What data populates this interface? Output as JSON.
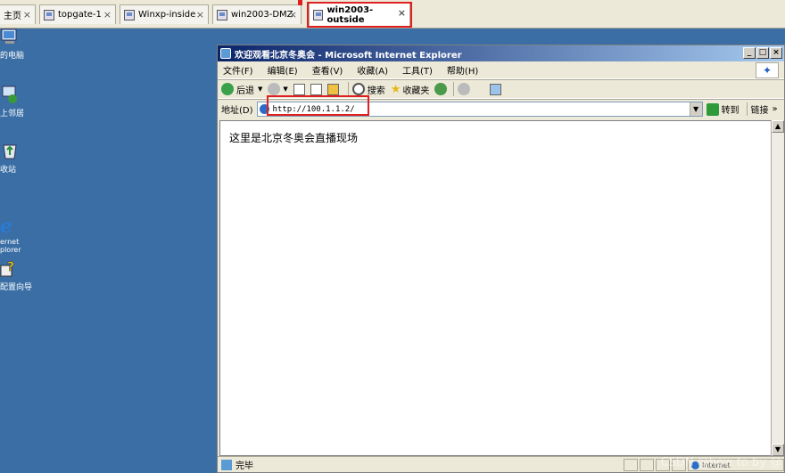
{
  "tabs": [
    {
      "label": "主页"
    },
    {
      "label": "topgate-1"
    },
    {
      "label": "Winxp-inside"
    },
    {
      "label": "win2003-DMZ"
    },
    {
      "label": "win2003-outside"
    }
  ],
  "tab_close_glyph": "×",
  "desktop": {
    "items": [
      {
        "label": "的电脑",
        "icon": "my-computer-icon"
      },
      {
        "label": "上邻居",
        "icon": "network-places-icon"
      },
      {
        "label": "收站",
        "icon": "recycle-bin-icon"
      },
      {
        "label": "ernet\nplorer",
        "icon": "internet-explorer-icon"
      },
      {
        "label": "配置向导",
        "icon": "config-wizard-icon"
      }
    ]
  },
  "ie": {
    "title": "欢迎观看北京冬奥会 - Microsoft Internet Explorer",
    "window_buttons": [
      "_",
      "□",
      "×"
    ],
    "menu": [
      "文件(F)",
      "编辑(E)",
      "查看(V)",
      "收藏(A)",
      "工具(T)",
      "帮助(H)"
    ],
    "toolbar": {
      "back": "后退",
      "search": "搜索",
      "favorites": "收藏夹"
    },
    "address": {
      "label": "地址(D)",
      "url": "http://100.1.1.2/",
      "go": "转到",
      "links": "链接"
    },
    "page_text": "这里是北京冬奥会直播现场",
    "status": {
      "text": "完毕",
      "zone": "Internet"
    }
  },
  "watermark": "CSDN @how to by @",
  "colors": {
    "desktop": "#3a6ea5",
    "highlight": "#e02020",
    "titlebar": "#0a246a"
  }
}
